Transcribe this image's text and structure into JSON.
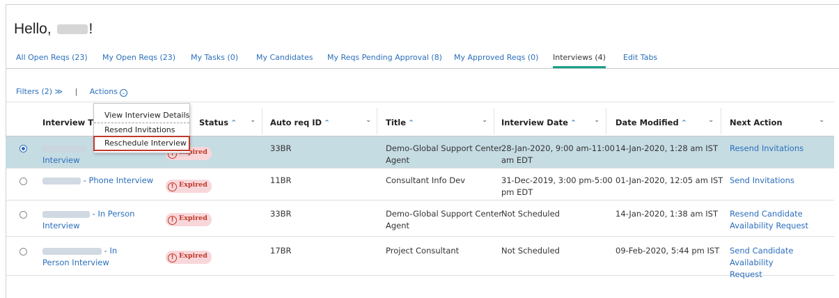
{
  "greeting": {
    "prefix": "Hello,",
    "suffix": "!"
  },
  "tabs": [
    {
      "label": "All Open Reqs (23)"
    },
    {
      "label": "My Open Reqs (23)"
    },
    {
      "label": "My Tasks (0)"
    },
    {
      "label": "My Candidates"
    },
    {
      "label": "My Reqs Pending Approval (8)"
    },
    {
      "label": "My Approved Reqs (0)"
    },
    {
      "label": "Interviews (4)",
      "active": true
    },
    {
      "label": "Edit Tabs"
    }
  ],
  "filters": {
    "label": "Filters (2) ≫",
    "separator": "|",
    "actions": "Actions"
  },
  "actions_menu": {
    "items": [
      "View Interview Details",
      "Resend Invitations",
      "Reschedule Interview"
    ]
  },
  "columns": [
    {
      "label": "Interview Ti"
    },
    {
      "label": "Status"
    },
    {
      "label": "Auto req ID"
    },
    {
      "label": "Title"
    },
    {
      "label": "Interview Date"
    },
    {
      "label": "Date Modified"
    },
    {
      "label": "Next Action"
    }
  ],
  "rows": [
    {
      "selected": true,
      "interview_suffix": "",
      "interview_line2": "Interview",
      "status": "Expired",
      "req_id": "33BR",
      "title_l1": "Demo-Global Support Center",
      "title_l2": "Agent",
      "date_l1": "28-Jan-2020, 9:00 am-11:00",
      "date_l2": "am EDT",
      "modified": "14-Jan-2020, 1:28 am IST",
      "action_l1": "Resend Invitations",
      "action_l2": ""
    },
    {
      "selected": false,
      "interview_suffix": "- Phone Interview",
      "interview_line2": "",
      "status": "Expired",
      "req_id": "11BR",
      "title_l1": "Consultant Info Dev",
      "title_l2": "",
      "date_l1": "31-Dec-2019, 3:00 pm-5:00",
      "date_l2": "pm EDT",
      "modified": "01-Jan-2020, 12:05 am IST",
      "action_l1": "Send Invitations",
      "action_l2": ""
    },
    {
      "selected": false,
      "interview_suffix": "- In Person",
      "interview_line2": "Interview",
      "status": "Expired",
      "req_id": "33BR",
      "title_l1": "Demo-Global Support Center",
      "title_l2": "Agent",
      "date_l1": "Not Scheduled",
      "date_l2": "",
      "modified": "14-Jan-2020, 1:38 am IST",
      "action_l1": "Resend Candidate",
      "action_l2": "Availability Request"
    },
    {
      "selected": false,
      "interview_suffix": "- In",
      "interview_line2": "Person Interview",
      "status": "Expired",
      "req_id": "17BR",
      "title_l1": "Project Consultant",
      "title_l2": "",
      "date_l1": "Not Scheduled",
      "date_l2": "",
      "modified": "09-Feb-2020, 5:44 pm IST",
      "action_l1": "Send Candidate Availability",
      "action_l2": "Request"
    }
  ],
  "colors": {
    "link": "#2a6ebb",
    "active_tab_underline": "#1a9e8a",
    "selected_row": "#c6dce3",
    "expired_bg": "#f8d7da",
    "expired_text": "#c0392b",
    "highlight_box": "#c0392b"
  }
}
